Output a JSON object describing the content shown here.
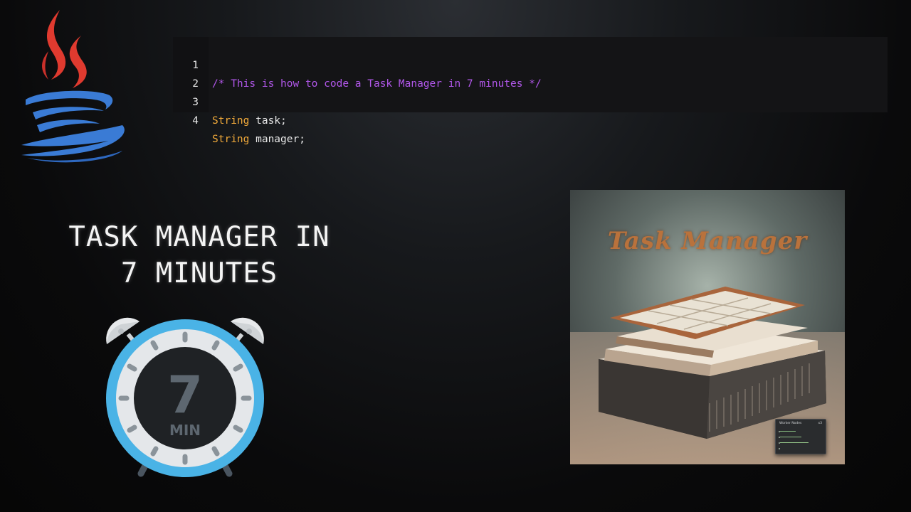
{
  "code": {
    "lines": [
      {
        "number": "1",
        "comment": "/* This is how to code a Task Manager in 7 minutes */",
        "type": "",
        "ident": ""
      },
      {
        "number": "2",
        "comment": "",
        "type": "",
        "ident": ""
      },
      {
        "number": "3",
        "comment": "",
        "type": "String",
        "ident": " task;"
      },
      {
        "number": "4",
        "comment": "",
        "type": "String",
        "ident": " manager;"
      }
    ]
  },
  "title": {
    "line1": "TASK MANAGER IN",
    "line2": "7 MINUTES"
  },
  "clock": {
    "number": "7",
    "unit": "MIN"
  },
  "artwork": {
    "title": "Task Manager",
    "panel_title": "Worker Nodes",
    "panel_close": "x3"
  },
  "colors": {
    "comment": "#b157ea",
    "keyword_type": "#f0a93a",
    "clock_ring": "#4ab3e6",
    "clock_face_dark": "#1f2225",
    "java_red": "#e03a2f",
    "java_blue": "#3a7bd5"
  },
  "icons": {
    "logo": "java-logo-icon",
    "clock": "alarm-clock-icon"
  }
}
